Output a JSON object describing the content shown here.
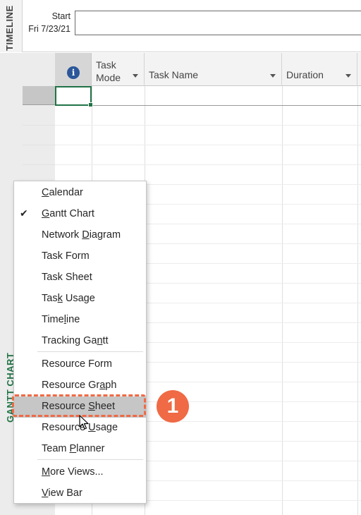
{
  "timeline": {
    "side_label": "TIMELINE",
    "start_label": "Start",
    "start_date": "Fri 7/23/21"
  },
  "gantt": {
    "side_label": "GANTT CHART"
  },
  "grid": {
    "columns": [
      {
        "key": "info",
        "label": "",
        "icon": "info-icon"
      },
      {
        "key": "task_mode",
        "label_line1": "Task",
        "label_line2": "Mode"
      },
      {
        "key": "task_name",
        "label": "Task Name"
      },
      {
        "key": "duration",
        "label": "Duration"
      }
    ]
  },
  "menu": {
    "items": [
      {
        "label_pre": "",
        "mnemonic": "C",
        "label_post": "alendar",
        "checked": false
      },
      {
        "label_pre": "",
        "mnemonic": "G",
        "label_post": "antt Chart",
        "checked": true
      },
      {
        "label_pre": "Network ",
        "mnemonic": "D",
        "label_post": "iagram",
        "checked": false
      },
      {
        "label_pre": "Task Form",
        "mnemonic": "",
        "label_post": "",
        "checked": false
      },
      {
        "label_pre": "Task Sheet",
        "mnemonic": "",
        "label_post": "",
        "checked": false
      },
      {
        "label_pre": "Tas",
        "mnemonic": "k",
        "label_post": " Usage",
        "checked": false
      },
      {
        "label_pre": "Time",
        "mnemonic": "l",
        "label_post": "ine",
        "checked": false
      },
      {
        "label_pre": "Tracking Ga",
        "mnemonic": "n",
        "label_post": "tt",
        "checked": false
      },
      {
        "label_pre": "Resource Form",
        "mnemonic": "",
        "label_post": "",
        "checked": false
      },
      {
        "label_pre": "Resource Gr",
        "mnemonic": "a",
        "label_post": "ph",
        "checked": false
      },
      {
        "label_pre": "Resource ",
        "mnemonic": "S",
        "label_post": "heet",
        "checked": false,
        "highlighted": true
      },
      {
        "label_pre": "Resource ",
        "mnemonic": "U",
        "label_post": "sage",
        "checked": false
      },
      {
        "label_pre": "Team ",
        "mnemonic": "P",
        "label_post": "lanner",
        "checked": false
      },
      {
        "label_pre": "",
        "mnemonic": "M",
        "label_post": "ore Views...",
        "checked": false
      },
      {
        "label_pre": "",
        "mnemonic": "V",
        "label_post": "iew Bar",
        "checked": false
      }
    ],
    "check_glyph": "✔"
  },
  "annotation": {
    "step_number": "1",
    "color": "#ef6a45"
  },
  "colors": {
    "accent_green": "#217346",
    "info_blue": "#2b579a",
    "highlight_gray": "#c6c6c6"
  }
}
